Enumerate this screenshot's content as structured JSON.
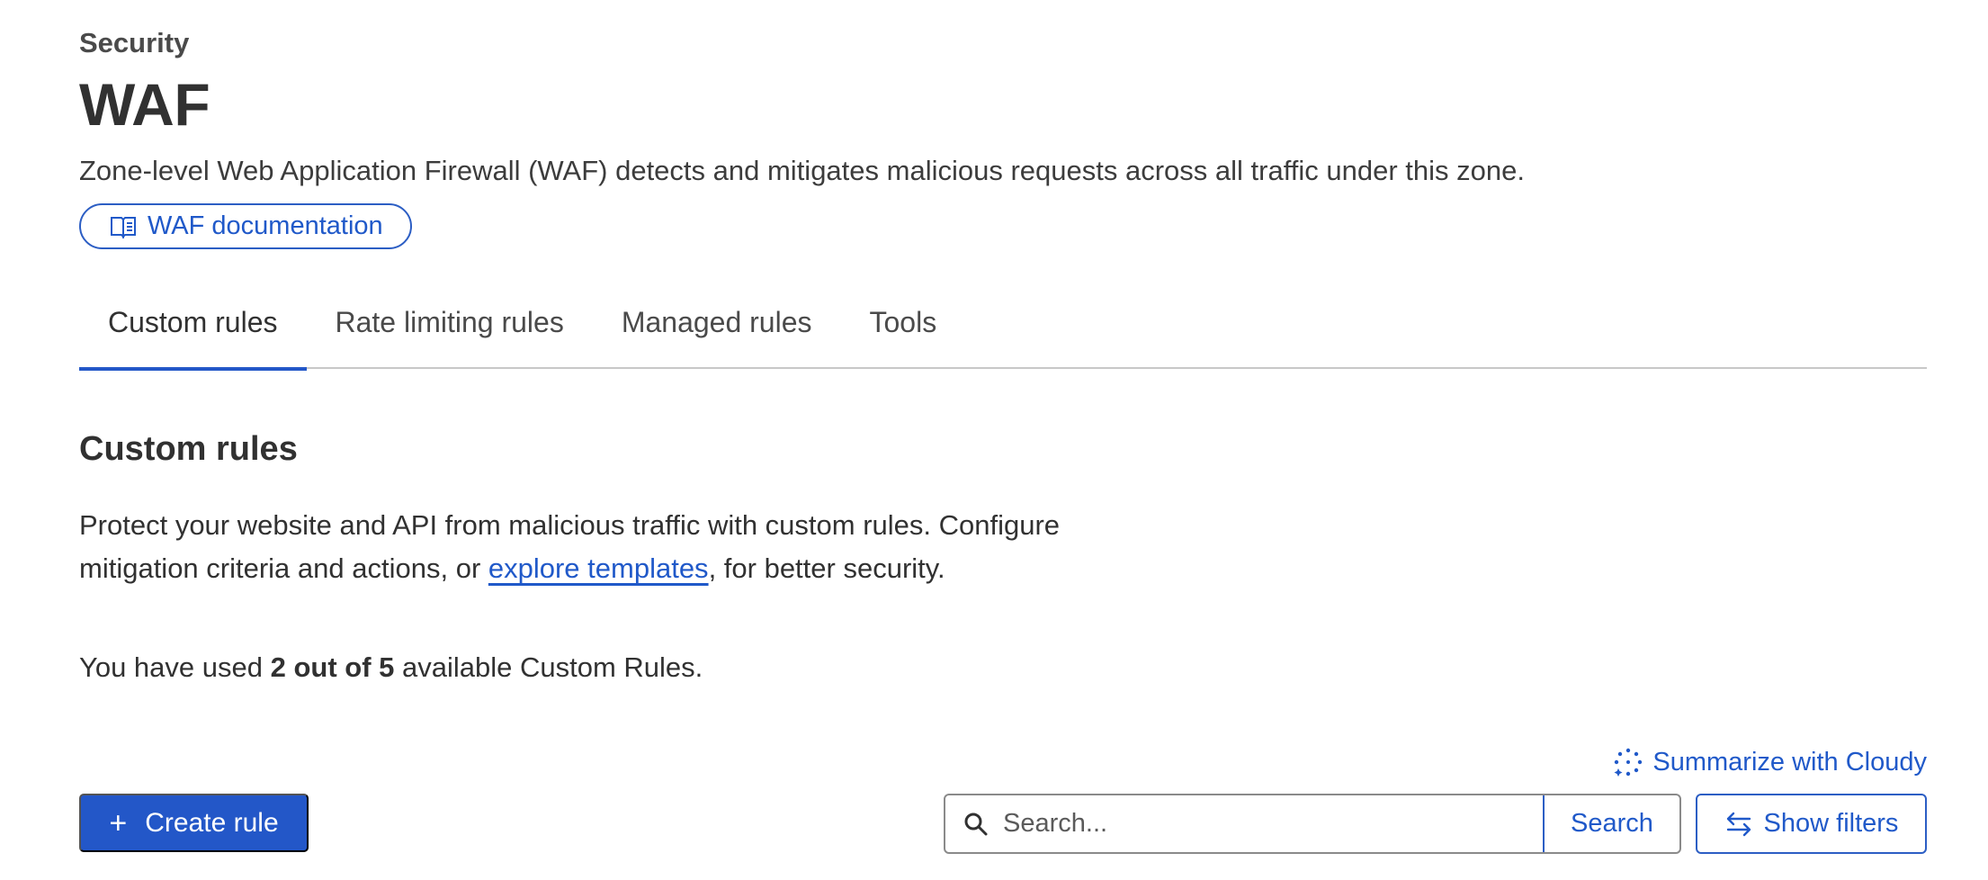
{
  "header": {
    "eyebrow": "Security",
    "title": "WAF",
    "subtitle": "Zone-level Web Application Firewall (WAF) detects and mitigates malicious requests across all traffic under this zone.",
    "doc_link_label": "WAF documentation",
    "doc_link_icon": "book-icon"
  },
  "tabs": [
    {
      "label": "Custom rules",
      "active": true
    },
    {
      "label": "Rate limiting rules",
      "active": false
    },
    {
      "label": "Managed rules",
      "active": false
    },
    {
      "label": "Tools",
      "active": false
    }
  ],
  "section": {
    "title": "Custom rules",
    "desc_before": "Protect your website and API from malicious traffic with custom rules. Configure mitigation criteria and actions, or ",
    "desc_link": "explore templates",
    "desc_after": ", for better security.",
    "usage_prefix": "You have used ",
    "usage_count": "2 out of 5",
    "usage_suffix": " available Custom Rules."
  },
  "toolbar": {
    "summarize_label": "Summarize with Cloudy",
    "summarize_icon": "sparkle-icon",
    "create_label": "Create rule",
    "search_placeholder": "Search...",
    "search_button": "Search",
    "filters_label": "Show filters",
    "filters_icon": "swap-arrows-icon"
  },
  "colors": {
    "accent": "#2357c8",
    "link": "#2059c9",
    "text": "#313131",
    "divider": "#c8c8c8"
  }
}
